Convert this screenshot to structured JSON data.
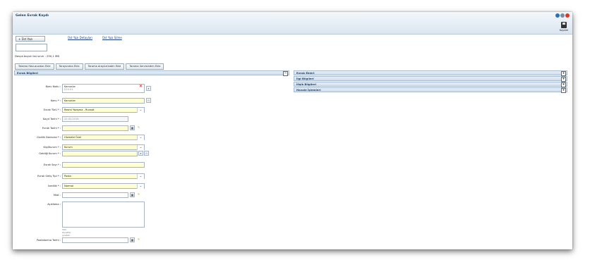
{
  "window": {
    "title": "Gelen Evrak Kaydı",
    "save_label": "Kaydet"
  },
  "toolbar": {
    "add_label": "+  Üst Yazı",
    "link_details": "Üst Yazı Detayları",
    "link_delete": "Üst Yazı Silme",
    "max_size": "Dosya boyut üst sınırı : 250,1 MB"
  },
  "tabs": [
    "Tarama Havuzundan Ekle",
    "Tarayıcıdan Ekle",
    "Tarama Arayüzünden Ekle",
    "Tarama Servisinden Ekle"
  ],
  "left_panel": {
    "title": "Evrak Bilgileri",
    "toggle": "−"
  },
  "form": {
    "konu_kodu": {
      "label": "Konu Kodu :",
      "value": "Kanunlar",
      "sub": "010.01"
    },
    "konu": {
      "label": "Konu * :",
      "value": "Kanunlar"
    },
    "evrak_turu": {
      "label": "Evrak Türü * :",
      "value": "Resmi Yazışma - Runsat"
    },
    "kayit_tarihi": {
      "label": "Kayıt Tarihi * :",
      "value": "22.03.2016"
    },
    "evrak_tarihi": {
      "label": "Evrak Tarihi * :",
      "value": ""
    },
    "gizlilik": {
      "label": "Gizlilik Derecesi * :",
      "value": "Hizmete Özel"
    },
    "kisi_kurum": {
      "label": "Kişi/Kurum * :",
      "value": "Kurum"
    },
    "geldigi_kurum": {
      "label": "Geldiği Kurum * :",
      "value": ""
    },
    "evrak_sayi": {
      "label": "Evrak Sayı * :",
      "value": ""
    },
    "gelis_tipi": {
      "label": "Evrak Geliş Tipi * :",
      "value": "Posta"
    },
    "ivedilik": {
      "label": "İvedilik * :",
      "value": "Normal"
    },
    "miat": {
      "label": "Miat :",
      "value": ""
    },
    "aciklama": {
      "label": "Açıklama :",
      "hint": "500 karakter girebilir"
    },
    "postalama": {
      "label": "Postalanma Tarihi :",
      "value": ""
    }
  },
  "right_panels": [
    {
      "title": "Evrak Ekleri",
      "toggle": "+"
    },
    {
      "title": "İlgi Bilgileri",
      "toggle": "+"
    },
    {
      "title": "İlişik Bilgileri",
      "toggle": "+"
    },
    {
      "title": "Havale İşlemleri",
      "toggle": "+"
    }
  ],
  "colors": {
    "header_bg": "#dbe6f1",
    "required_field": "#ffffd1",
    "link": "#1a3f8c"
  }
}
